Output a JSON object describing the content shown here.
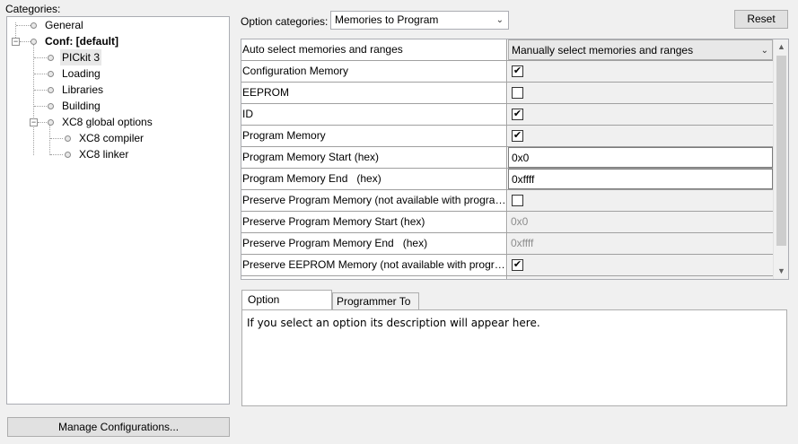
{
  "categories": {
    "label": "Categories:",
    "tree": [
      {
        "label": "General"
      },
      {
        "label": "Conf: [default]"
      },
      {
        "label": "PICkit 3"
      },
      {
        "label": "Loading"
      },
      {
        "label": "Libraries"
      },
      {
        "label": "Building"
      },
      {
        "label": "XC8 global options"
      },
      {
        "label": "XC8 compiler"
      },
      {
        "label": "XC8 linker"
      }
    ],
    "manage_button": "Manage Configurations..."
  },
  "options": {
    "label": "Option categories:",
    "selected": "Memories to Program",
    "reset_button": "Reset"
  },
  "grid": {
    "rows": [
      {
        "name": "Auto select memories and ranges",
        "value": "Manually select memories and ranges"
      },
      {
        "name": "Configuration Memory",
        "checked": true
      },
      {
        "name": "EEPROM",
        "checked": false
      },
      {
        "name": "ID",
        "checked": true
      },
      {
        "name": "Program Memory",
        "checked": true
      },
      {
        "name": "Program Memory Start (hex)",
        "value": "0x0"
      },
      {
        "name": "Program Memory End   (hex)",
        "value": "0xffff"
      },
      {
        "name": "Preserve Program Memory (not available with programmer to go)",
        "checked": false
      },
      {
        "name": "Preserve Program Memory Start (hex)",
        "value": "0x0"
      },
      {
        "name": "Preserve Program Memory End   (hex)",
        "value": "0xffff"
      },
      {
        "name": "Preserve EEPROM Memory (not available with programmer to go)",
        "checked": true
      }
    ]
  },
  "description": {
    "tabs": [
      "Option Description",
      "Programmer To Go"
    ],
    "text": "If you select an option its description will appear here."
  }
}
